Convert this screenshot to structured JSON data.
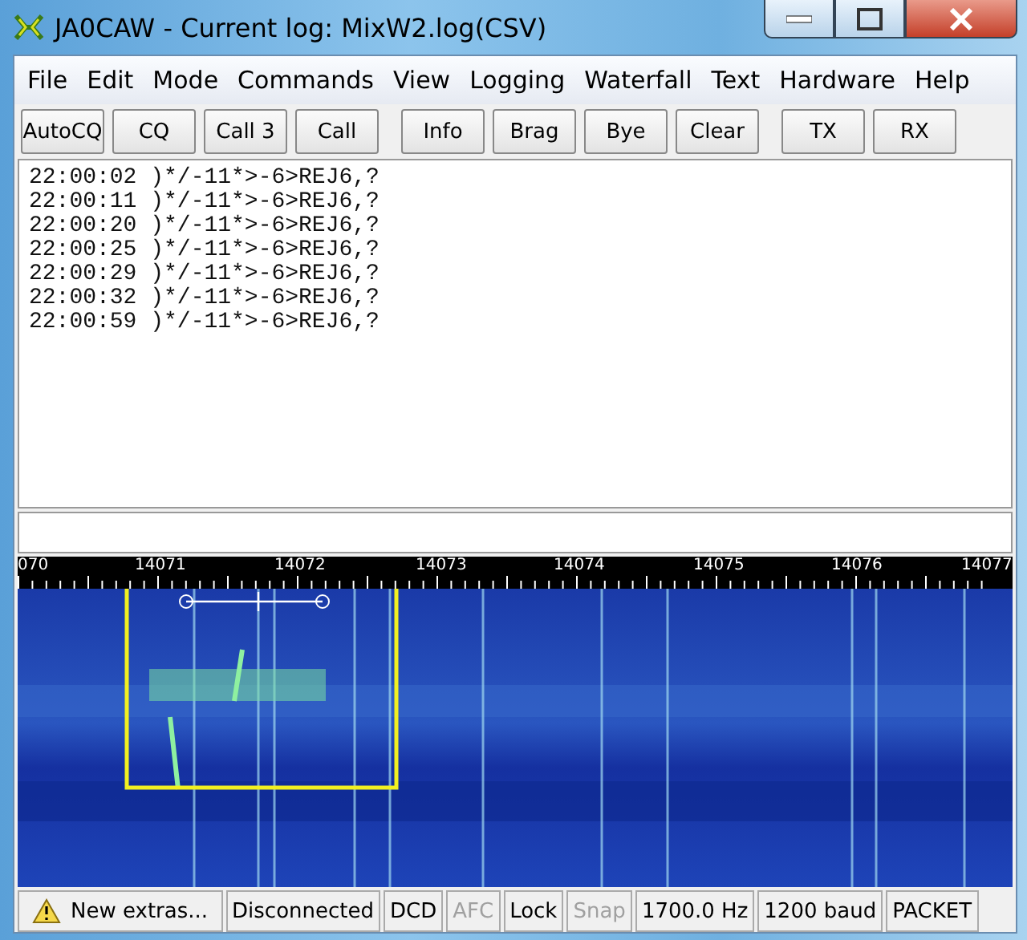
{
  "window": {
    "title": "JA0CAW - Current log: MixW2.log(CSV)"
  },
  "menu": [
    "File",
    "Edit",
    "Mode",
    "Commands",
    "View",
    "Logging",
    "Waterfall",
    "Text",
    "Hardware",
    "Help"
  ],
  "toolbar": [
    [
      "AutoCQ",
      "CQ",
      "Call 3",
      "Call"
    ],
    [
      "Info",
      "Brag",
      "Bye",
      "Clear"
    ],
    [
      "TX",
      "RX"
    ]
  ],
  "receive_lines": [
    "22:00:02 )*/-11*>-6>REJ6,?",
    "22:00:11 )*/-11*>-6>REJ6,?",
    "22:00:20 )*/-11*>-6>REJ6,?",
    "22:00:25 )*/-11*>-6>REJ6,?",
    "22:00:29 )*/-11*>-6>REJ6,?",
    "22:00:32 )*/-11*>-6>REJ6,?",
    "22:00:59 )*/-11*>-6>REJ6,?"
  ],
  "waterfall": {
    "ruler_labels": [
      "070",
      "14071",
      "14072",
      "14073",
      "14074",
      "14075",
      "14076",
      "14077"
    ]
  },
  "status_bar": [
    {
      "text": "New extras...",
      "kind": "warning",
      "disabled": false
    },
    {
      "text": "Disconnected",
      "kind": "text",
      "disabled": false
    },
    {
      "text": "DCD",
      "kind": "text",
      "disabled": false
    },
    {
      "text": "AFC",
      "kind": "text",
      "disabled": true
    },
    {
      "text": "Lock",
      "kind": "text",
      "disabled": false
    },
    {
      "text": "Snap",
      "kind": "text",
      "disabled": true
    },
    {
      "text": "1700.0 Hz",
      "kind": "text",
      "disabled": false
    },
    {
      "text": "1200 baud",
      "kind": "text",
      "disabled": false
    },
    {
      "text": "PACKET",
      "kind": "text",
      "disabled": false
    }
  ]
}
